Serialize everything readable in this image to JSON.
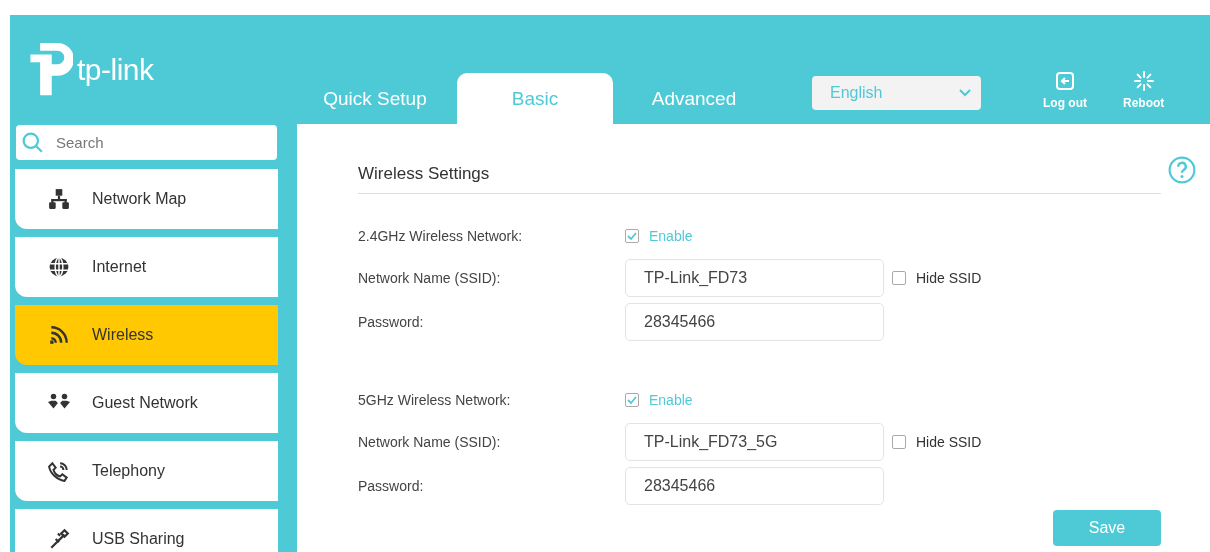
{
  "logo": {
    "text": "tp-link"
  },
  "tabs": [
    {
      "label": "Quick Setup",
      "selected": false
    },
    {
      "label": "Basic",
      "selected": true
    },
    {
      "label": "Advanced",
      "selected": false
    }
  ],
  "language": {
    "value": "English"
  },
  "header_actions": [
    {
      "kind": "logout",
      "label": "Log out"
    },
    {
      "kind": "reboot",
      "label": "Reboot"
    }
  ],
  "search": {
    "placeholder": "Search"
  },
  "sidebar": {
    "items": [
      {
        "kind": "map",
        "label": "Network Map",
        "selected": false
      },
      {
        "kind": "globe",
        "label": "Internet",
        "selected": false
      },
      {
        "kind": "wireless",
        "label": "Wireless",
        "selected": true
      },
      {
        "kind": "guest",
        "label": "Guest Network",
        "selected": false
      },
      {
        "kind": "phone",
        "label": "Telephony",
        "selected": false
      },
      {
        "kind": "usb",
        "label": "USB Sharing",
        "selected": false
      }
    ]
  },
  "section": {
    "title": "Wireless Settings"
  },
  "networks": [
    {
      "label": "2.4GHz Wireless Network:",
      "enable_label": "Enable",
      "enabled": true,
      "ssid_label": "Network Name (SSID):",
      "ssid": "TP-Link_FD73",
      "hide_label": "Hide SSID",
      "hidden": false,
      "password_label": "Password:",
      "password": "28345466"
    },
    {
      "label": "5GHz Wireless Network:",
      "enable_label": "Enable",
      "enabled": true,
      "ssid_label": "Network Name (SSID):",
      "ssid": "TP-Link_FD73_5G",
      "hide_label": "Hide SSID",
      "hidden": false,
      "password_label": "Password:",
      "password": "28345466"
    }
  ],
  "save_button": "Save"
}
